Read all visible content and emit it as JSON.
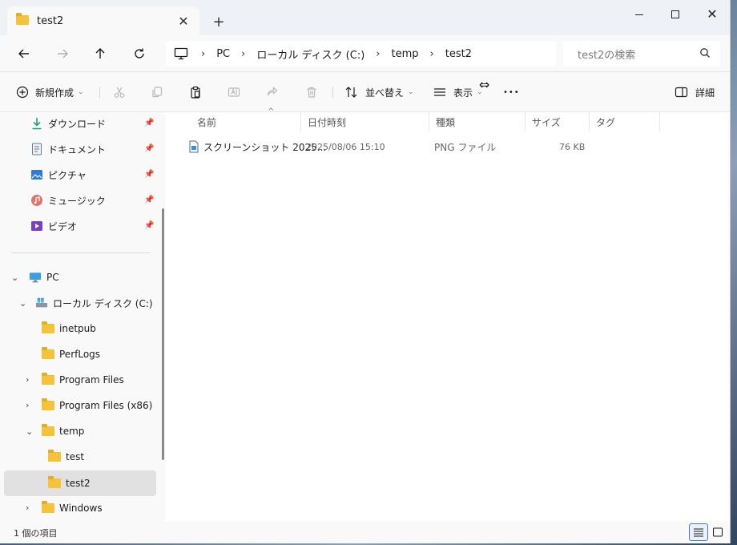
{
  "window": {
    "tab_title": "test2",
    "new_tab": "+",
    "close_tab": "✕"
  },
  "addressbar": {
    "crumbs": [
      "PC",
      "ローカル ディスク (C:)",
      "temp",
      "test2"
    ],
    "separator": "›",
    "search_placeholder": "test2の検索"
  },
  "commandbar": {
    "new_label": "新規作成",
    "sort_label": "並べ替え",
    "view_label": "表示",
    "more_label": "•••",
    "details_label": "詳細"
  },
  "sidebar": {
    "quick_access": [
      {
        "label": "ダウンロード",
        "icon": "download-icon"
      },
      {
        "label": "ドキュメント",
        "icon": "document-icon"
      },
      {
        "label": "ピクチャ",
        "icon": "pictures-icon"
      },
      {
        "label": "ミュージック",
        "icon": "music-icon"
      },
      {
        "label": "ビデオ",
        "icon": "video-icon"
      }
    ],
    "tree": [
      {
        "label": "PC",
        "icon": "pc-icon"
      },
      {
        "label": "ローカル ディスク (C:)",
        "icon": "drive-icon"
      },
      {
        "label": "inetpub"
      },
      {
        "label": "PerfLogs"
      },
      {
        "label": "Program Files"
      },
      {
        "label": "Program Files (x86)"
      },
      {
        "label": "temp"
      },
      {
        "label": "test"
      },
      {
        "label": "test2"
      },
      {
        "label": "Windows"
      }
    ]
  },
  "filelist": {
    "columns": [
      "名前",
      "日付時刻",
      "種類",
      "サイズ",
      "タグ"
    ],
    "rows": [
      {
        "name": "スクリーンショット 2025...",
        "date": "2025/08/06 15:10",
        "type": "PNG ファイル",
        "size": "76 KB",
        "tags": ""
      }
    ]
  },
  "statusbar": {
    "item_count": "1 個の項目"
  },
  "colors": {
    "accent": "#0067c0",
    "folder": "#f5c33b",
    "selected_bg": "#e1e1e1"
  }
}
